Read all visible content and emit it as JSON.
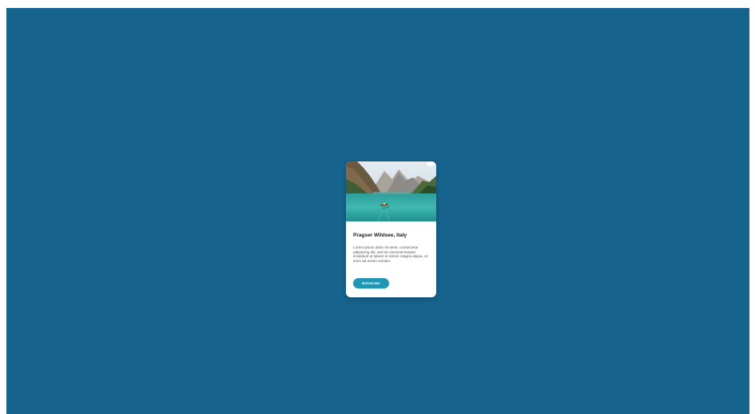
{
  "card": {
    "image_alt": "Boat on turquoise lake with mountains",
    "title": "Pragser Wildsee, Italy",
    "text": "Lorem ipsum dolor sit amet, consectetur adipiscing elit, sed do eiusmod tempor incididunt ut labore et dolore magna aliqua. Ut enim ad minim veniam.",
    "button_label": "BOOKING"
  },
  "colors": {
    "background": "#16638d",
    "card": "#ffffff",
    "button": "#2196b3",
    "lake": "#3fb8b0"
  },
  "icons": {
    "card_image": "landscape-photo"
  }
}
